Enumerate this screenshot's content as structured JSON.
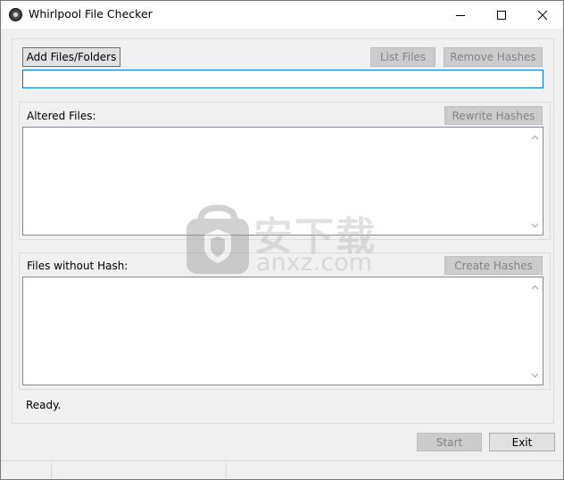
{
  "window": {
    "title": "Whirlpool File Checker",
    "minimize_icon": "minimize-icon",
    "maximize_icon": "maximize-icon",
    "close_icon": "close-icon"
  },
  "top_panel": {
    "add_button": "Add Files/Folders",
    "list_files_button": "List Files",
    "remove_hashes_button": "Remove Hashes",
    "path_value": ""
  },
  "altered_panel": {
    "label": "Altered Files:",
    "rewrite_button": "Rewrite Hashes",
    "items": []
  },
  "without_hash_panel": {
    "label": "Files without Hash:",
    "create_button": "Create Hashes",
    "items": []
  },
  "status": "Ready.",
  "bottom": {
    "start_button": "Start",
    "exit_button": "Exit"
  },
  "watermark": {
    "cn_text": "安下载",
    "en_text": "anxz.com"
  },
  "colors": {
    "focus_border": "#0078d7",
    "disabled_text": "#838383",
    "window_bg": "#f0f0f0"
  }
}
